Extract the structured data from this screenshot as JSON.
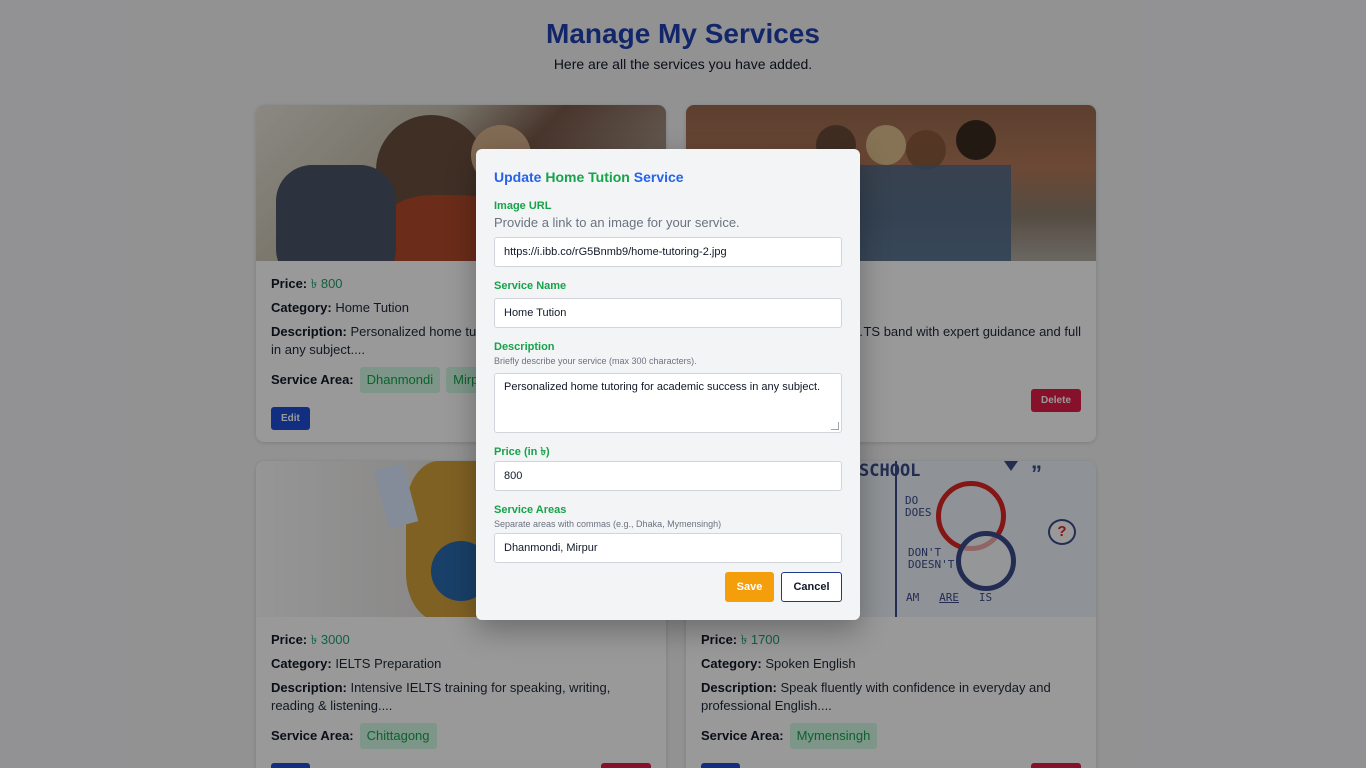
{
  "header": {
    "title": "Manage My Services",
    "subtitle": "Here are all the services you have added."
  },
  "labels": {
    "price": "Price:",
    "category": "Category:",
    "description": "Description:",
    "service_area": "Service Area:",
    "edit": "Edit",
    "delete": "Delete",
    "currency": "৳"
  },
  "cards": [
    {
      "price": "৳ 800",
      "category": "Home Tution",
      "description": "Personalized home tutoring for academic success in any subject....",
      "areas": [
        "Dhanmondi",
        "Mirpur"
      ]
    },
    {
      "price": "",
      "category": "",
      "description": "…TS band with expert guidance and full",
      "areas": []
    },
    {
      "price": "৳ 3000",
      "category": "IELTS Preparation",
      "description": "Intensive IELTS training for speaking, writing, reading & listening....",
      "areas": [
        "Chittagong"
      ]
    },
    {
      "price": "৳ 1700",
      "category": "Spoken English",
      "description": "Speak fluently with confidence in everyday and professional English....",
      "areas": [
        "Mymensingh"
      ]
    }
  ],
  "school_image": {
    "school_text": "SCHOOL",
    "do": "DO",
    "does": "DOES",
    "dont": "DON'T",
    "doesnt": "DOESN'T",
    "am": "AM",
    "are": "ARE",
    "is": "IS",
    "question": "?"
  },
  "modal": {
    "title_part1": "Update ",
    "title_part2": "Home Tution",
    "title_part3": " Service",
    "image_url_label": "Image URL",
    "image_url_help": "Provide a link to an image for your service.",
    "image_url_value": "https://i.ibb.co/rG5Bnmb9/home-tutoring-2.jpg",
    "service_name_label": "Service Name",
    "service_name_value": "Home Tution",
    "description_label": "Description",
    "description_help": "Briefly describe your service (max 300 characters).",
    "description_value": "Personalized home tutoring for academic success in any subject.",
    "price_label": "Price (in ৳)",
    "price_value": "800",
    "areas_label": "Service Areas",
    "areas_help": "Separate areas with commas (e.g., Dhaka, Mymensingh)",
    "areas_value": "Dhanmondi, Mirpur",
    "save_label": "Save",
    "cancel_label": "Cancel"
  },
  "colors": {
    "title_blue": "#1e40af",
    "accent_green": "#16a34a",
    "edit_blue": "#1d4ed8",
    "delete_red": "#e11d48",
    "save_amber": "#f59e0b"
  }
}
